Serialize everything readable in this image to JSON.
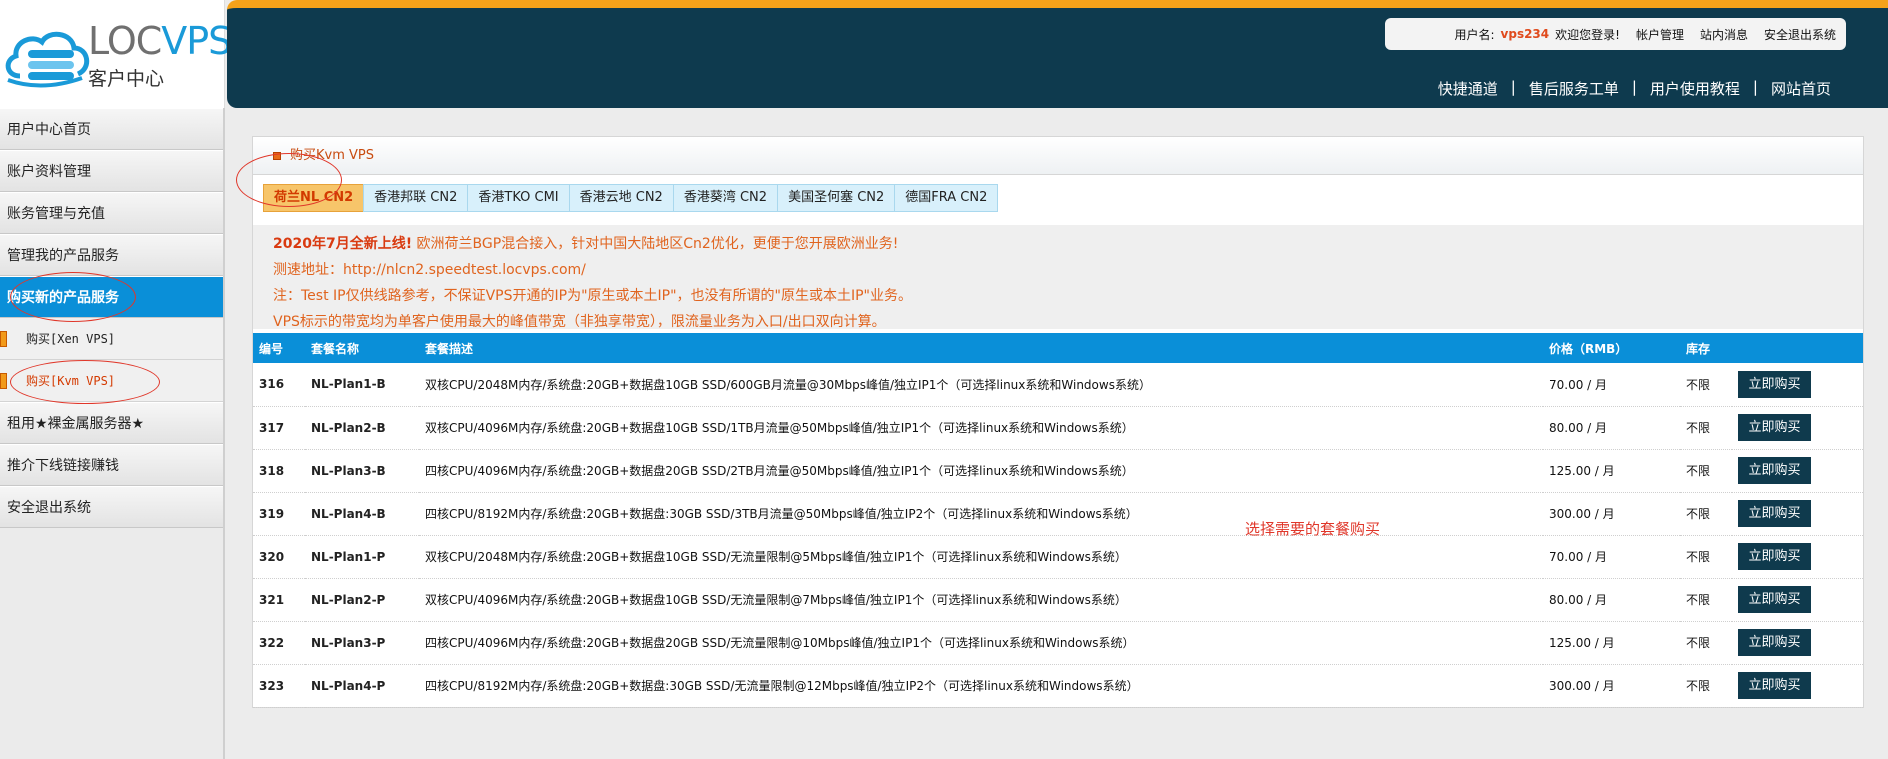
{
  "logo": {
    "brand_loc": "LOC",
    "brand_vps": "VPS",
    "subtitle": "客户中心"
  },
  "userbar": {
    "label": "用户名:",
    "username": "vps234",
    "welcome": "欢迎您登录!",
    "links": [
      "帐户管理",
      "站内消息",
      "安全退出系统"
    ]
  },
  "topnav": [
    "快捷通道",
    "售后服务工单",
    "用户使用教程",
    "网站首页"
  ],
  "sidebar": {
    "items": [
      {
        "label": "用户中心首页"
      },
      {
        "label": "账户资料管理"
      },
      {
        "label": "账务管理与充值"
      },
      {
        "label": "管理我的产品服务"
      },
      {
        "label": "购买新的产品服务"
      }
    ],
    "sub_items": [
      {
        "label": "购买[Xen VPS]"
      },
      {
        "label": "购买[Kvm VPS]"
      }
    ],
    "items_after": [
      {
        "label": "租用★裸金属服务器★"
      },
      {
        "label": "推介下线链接赚钱"
      },
      {
        "label": "安全退出系统"
      }
    ]
  },
  "panel": {
    "title": "购买Kvm VPS"
  },
  "tabs": [
    {
      "label": "荷兰NL CN2"
    },
    {
      "label": "香港邦联 CN2"
    },
    {
      "label": "香港TKO CMI"
    },
    {
      "label": "香港云地 CN2"
    },
    {
      "label": "香港葵湾 CN2"
    },
    {
      "label": "美国圣何塞 CN2"
    },
    {
      "label": "德国FRA CN2"
    }
  ],
  "notice": {
    "line1_strong": "2020年7月全新上线!",
    "line1_rest": " 欧洲荷兰BGP混合接入，针对中国大陆地区Cn2优化，更便于您开展欧洲业务!",
    "line2": "测速地址：http://nlcn2.speedtest.locvps.com/",
    "line3": "注：Test IP仅供线路参考，不保证VPS开通的IP为\"原生或本土IP\"，也没有所谓的\"原生或本土IP\"业务。",
    "line4": "VPS标示的带宽均为单客户使用最大的峰值带宽（非独享带宽），限流量业务为入口/出口双向计算。"
  },
  "table": {
    "headers": {
      "id": "编号",
      "name": "套餐名称",
      "desc": "套餐描述",
      "price": "价格（RMB）",
      "stock": "库存"
    },
    "buy_label": "立即购买",
    "rows": [
      {
        "id": "316",
        "name": "NL-Plan1-B",
        "desc": "双核CPU/2048M内存/系统盘:20GB+数据盘10GB SSD/600GB月流量@30Mbps峰值/独立IP1个（可选择linux系统和Windows系统）",
        "price": "70.00 / 月",
        "stock": "不限"
      },
      {
        "id": "317",
        "name": "NL-Plan2-B",
        "desc": "双核CPU/4096M内存/系统盘:20GB+数据盘10GB SSD/1TB月流量@50Mbps峰值/独立IP1个（可选择linux系统和Windows系统）",
        "price": "80.00 / 月",
        "stock": "不限"
      },
      {
        "id": "318",
        "name": "NL-Plan3-B",
        "desc": "四核CPU/4096M内存/系统盘:20GB+数据盘20GB SSD/2TB月流量@50Mbps峰值/独立IP1个（可选择linux系统和Windows系统）",
        "price": "125.00 / 月",
        "stock": "不限"
      },
      {
        "id": "319",
        "name": "NL-Plan4-B",
        "desc": "四核CPU/8192M内存/系统盘:20GB+数据盘:30GB SSD/3TB月流量@50Mbps峰值/独立IP2个（可选择linux系统和Windows系统）",
        "price": "300.00 / 月",
        "stock": "不限"
      },
      {
        "id": "320",
        "name": "NL-Plan1-P",
        "desc": "双核CPU/2048M内存/系统盘:20GB+数据盘10GB SSD/无流量限制@5Mbps峰值/独立IP1个（可选择linux系统和Windows系统）",
        "price": "70.00 / 月",
        "stock": "不限"
      },
      {
        "id": "321",
        "name": "NL-Plan2-P",
        "desc": "双核CPU/4096M内存/系统盘:20GB+数据盘10GB SSD/无流量限制@7Mbps峰值/独立IP1个（可选择linux系统和Windows系统）",
        "price": "80.00 / 月",
        "stock": "不限"
      },
      {
        "id": "322",
        "name": "NL-Plan3-P",
        "desc": "四核CPU/4096M内存/系统盘:20GB+数据盘20GB SSD/无流量限制@10Mbps峰值/独立IP1个（可选择linux系统和Windows系统）",
        "price": "125.00 / 月",
        "stock": "不限"
      },
      {
        "id": "323",
        "name": "NL-Plan4-P",
        "desc": "四核CPU/8192M内存/系统盘:20GB+数据盘:30GB SSD/无流量限制@12Mbps峰值/独立IP2个（可选择linux系统和Windows系统）",
        "price": "300.00 / 月",
        "stock": "不限"
      }
    ]
  },
  "annotation": "选择需要的套餐购买",
  "colors": {
    "accent": "#0a8fd8",
    "header": "#0e3a4e",
    "topbar": "#f5a21a",
    "notice": "#e0641f",
    "annotation": "#e0372a"
  }
}
